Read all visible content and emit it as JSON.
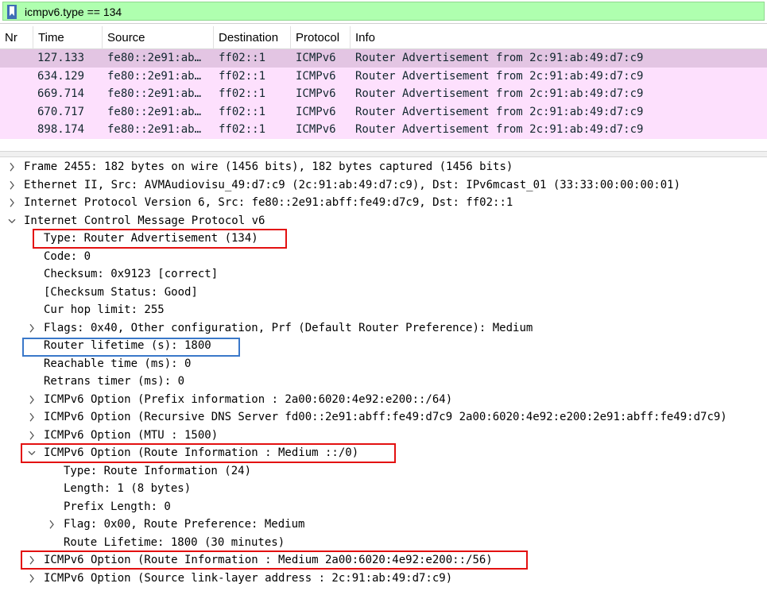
{
  "filter": {
    "text": "icmpv6.type == 134"
  },
  "columns": [
    "Nr",
    "Time",
    "Source",
    "Destination",
    "Protocol",
    "Info"
  ],
  "packets": [
    {
      "nr": "",
      "time": "127.133",
      "source": "fe80::2e91:ab…",
      "destination": "ff02::1",
      "protocol": "ICMPv6",
      "info": "Router Advertisement from 2c:91:ab:49:d7:c9"
    },
    {
      "nr": "",
      "time": "634.129",
      "source": "fe80::2e91:ab…",
      "destination": "ff02::1",
      "protocol": "ICMPv6",
      "info": "Router Advertisement from 2c:91:ab:49:d7:c9"
    },
    {
      "nr": "",
      "time": "669.714",
      "source": "fe80::2e91:ab…",
      "destination": "ff02::1",
      "protocol": "ICMPv6",
      "info": "Router Advertisement from 2c:91:ab:49:d7:c9"
    },
    {
      "nr": "",
      "time": "670.717",
      "source": "fe80::2e91:ab…",
      "destination": "ff02::1",
      "protocol": "ICMPv6",
      "info": "Router Advertisement from 2c:91:ab:49:d7:c9"
    },
    {
      "nr": "",
      "time": "898.174",
      "source": "fe80::2e91:ab…",
      "destination": "ff02::1",
      "protocol": "ICMPv6",
      "info": "Router Advertisement from 2c:91:ab:49:d7:c9"
    }
  ],
  "details": [
    {
      "text": "Frame 2455: 182 bytes on wire (1456 bits), 182 bytes captured (1456 bits)",
      "arrow": "collapsed"
    },
    {
      "text": "Ethernet II, Src: AVMAudiovisu_49:d7:c9 (2c:91:ab:49:d7:c9), Dst: IPv6mcast_01 (33:33:00:00:00:01)",
      "arrow": "collapsed"
    },
    {
      "text": "Internet Protocol Version 6, Src: fe80::2e91:abff:fe49:d7c9, Dst: ff02::1",
      "arrow": "collapsed"
    },
    {
      "text": "Internet Control Message Protocol v6",
      "arrow": "expanded"
    },
    {
      "text": "Type: Router Advertisement (134)",
      "arrow": "none"
    },
    {
      "text": "Code: 0",
      "arrow": "none"
    },
    {
      "text": "Checksum: 0x9123 [correct]",
      "arrow": "none"
    },
    {
      "text": "[Checksum Status: Good]",
      "arrow": "none"
    },
    {
      "text": "Cur hop limit: 255",
      "arrow": "none"
    },
    {
      "text": "Flags: 0x40, Other configuration, Prf (Default Router Preference): Medium",
      "arrow": "collapsed"
    },
    {
      "text": "Router lifetime (s): 1800",
      "arrow": "none"
    },
    {
      "text": "Reachable time (ms): 0",
      "arrow": "none"
    },
    {
      "text": "Retrans timer (ms): 0",
      "arrow": "none"
    },
    {
      "text": "ICMPv6 Option (Prefix information : 2a00:6020:4e92:e200::/64)",
      "arrow": "collapsed"
    },
    {
      "text": "ICMPv6 Option (Recursive DNS Server fd00::2e91:abff:fe49:d7c9 2a00:6020:4e92:e200:2e91:abff:fe49:d7c9)",
      "arrow": "collapsed"
    },
    {
      "text": "ICMPv6 Option (MTU : 1500)",
      "arrow": "collapsed"
    },
    {
      "text": "ICMPv6 Option (Route Information : Medium ::/0)",
      "arrow": "expanded"
    },
    {
      "text": "Type: Route Information (24)",
      "arrow": "none"
    },
    {
      "text": "Length: 1 (8 bytes)",
      "arrow": "none"
    },
    {
      "text": "Prefix Length: 0",
      "arrow": "none"
    },
    {
      "text": "Flag: 0x00, Route Preference: Medium",
      "arrow": "collapsed"
    },
    {
      "text": "Route Lifetime: 1800 (30 minutes)",
      "arrow": "none"
    },
    {
      "text": "ICMPv6 Option (Route Information : Medium 2a00:6020:4e92:e200::/56)",
      "arrow": "collapsed"
    },
    {
      "text": "ICMPv6 Option (Source link-layer address : 2c:91:ab:49:d7:c9)",
      "arrow": "collapsed"
    }
  ],
  "colors": {
    "filter_ok": "#afffaf",
    "row_bg": "#fde0fd",
    "row_selected": "#e3c5e3",
    "highlight_red": "#e31010",
    "highlight_blue": "#3a78c9"
  },
  "icons": {
    "filter": "bookmark-icon",
    "collapsed": "chevron-right-icon",
    "expanded": "chevron-down-icon"
  }
}
